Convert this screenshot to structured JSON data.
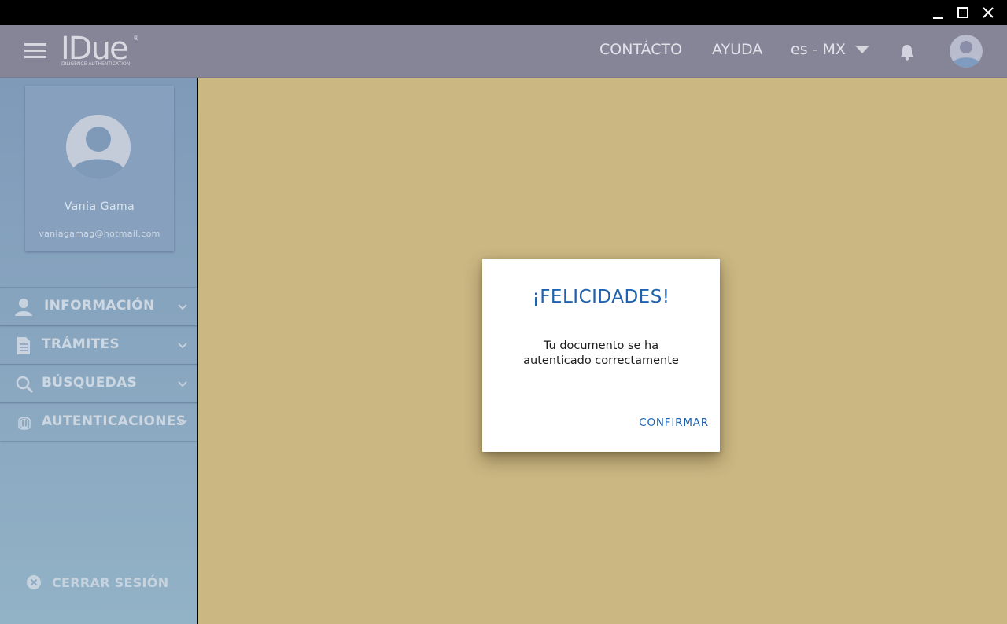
{
  "window": {
    "minimize_icon": "minimize-icon",
    "maximize_icon": "maximize-icon",
    "close_icon": "close-icon"
  },
  "header": {
    "logo_text": "IDue",
    "logo_registered": "®",
    "logo_subtitle": "DILIGENCE AUTHENTICATION",
    "nav": {
      "contacto": "CONTÁCTO",
      "ayuda": "AYUDA"
    },
    "language": "es - MX",
    "bell_icon": "bell-icon",
    "avatar_icon": "user-avatar-icon"
  },
  "profile": {
    "name": "Vania Gama",
    "email": "vaniagamag@hotmail.com"
  },
  "sidebar": {
    "items": [
      {
        "label": "INFORMACIÓN",
        "icon": "person-icon"
      },
      {
        "label": "TRÁMITES",
        "icon": "document-icon"
      },
      {
        "label": "BÚSQUEDAS",
        "icon": "search-icon"
      },
      {
        "label": "AUTENTICACIONES",
        "icon": "fingerprint-icon"
      }
    ],
    "logout": "CERRAR SESIÓN"
  },
  "modal": {
    "title": "¡FELICIDADES!",
    "message": "Tu documento se ha autenticado correctamente",
    "confirm": "CONFIRMAR"
  },
  "colors": {
    "header_bg": "#868597",
    "sidebar_bg": "#87a2bd",
    "main_overlay": "#cab782",
    "modal_accent": "#1c62b0"
  }
}
